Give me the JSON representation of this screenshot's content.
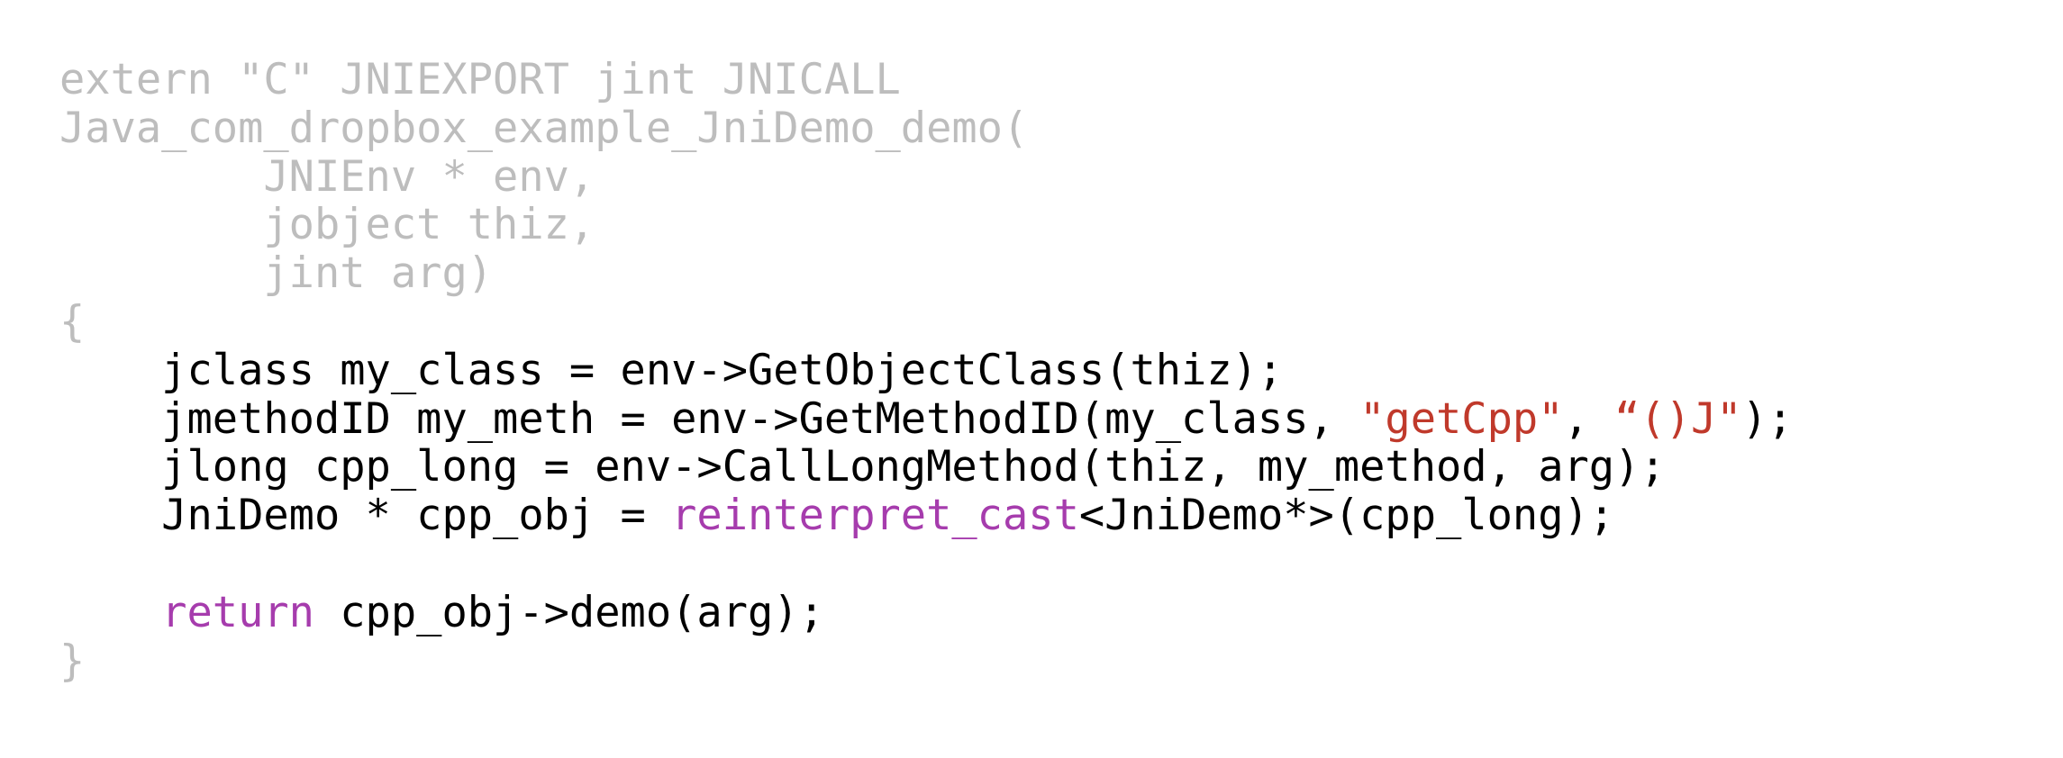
{
  "colors": {
    "background": "#ffffff",
    "dimmed_text": "#bdbdbd",
    "code_text": "#000000",
    "string_literal": "#c0392b",
    "keyword": "#a63cad"
  },
  "lines": {
    "l1": "extern \"C\" JNIEXPORT jint JNICALL",
    "l2": "Java_com_dropbox_example_JniDemo_demo(",
    "l3": "        JNIEnv * env,",
    "l4": "        jobject thiz,",
    "l5": "        jint arg)",
    "l6": "{",
    "l7": "    jclass my_class = env->GetObjectClass(thiz);",
    "l8a": "    jmethodID my_meth = env->GetMethodID(my_class, ",
    "l8b": "\"getCpp\"",
    "l8c": ", ",
    "l8d": "“()J\"",
    "l8e": ");",
    "l9": "    jlong cpp_long = env->CallLongMethod(thiz, my_method, arg);",
    "l10a": "    JniDemo * cpp_obj = ",
    "l10b": "reinterpret_cast",
    "l10c": "<JniDemo*>(cpp_long);",
    "l11": "",
    "l12a": "    ",
    "l12b": "return",
    "l12c": " cpp_obj->demo(arg);",
    "l13": "}"
  }
}
